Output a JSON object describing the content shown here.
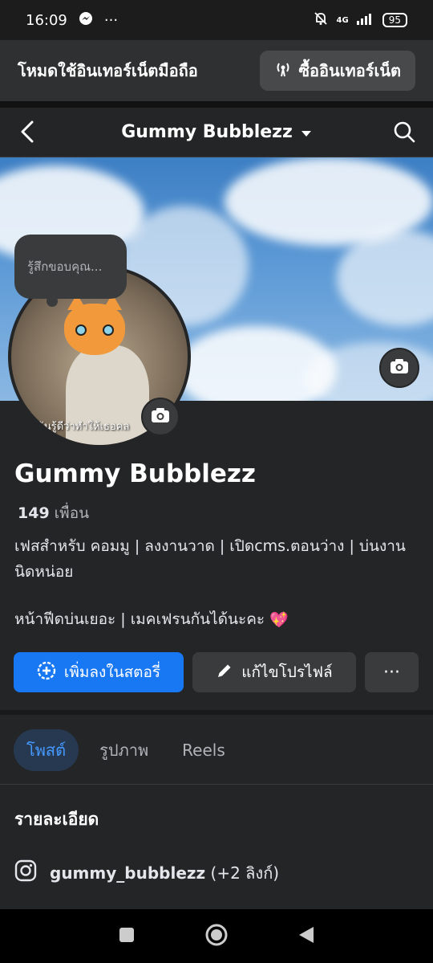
{
  "status": {
    "time": "16:09",
    "network": "4G",
    "battery": "95",
    "icons": [
      "messenger-icon",
      "more-dots-icon",
      "mute-bell-icon",
      "signal-icon"
    ]
  },
  "data_banner": {
    "label": "โหมดใช้อินเทอร์เน็ตมือถือ",
    "buy_button": "ซื้ออินเทอร์เน็ต"
  },
  "topbar": {
    "title": "Gummy Bubblezz"
  },
  "note_bubble": {
    "text": "รู้สึกขอบคุณ..."
  },
  "avatar": {
    "caption": "ฉันรู้ดีว่าทำให้เธอคล"
  },
  "profile": {
    "name": "Gummy Bubblezz",
    "friends_count": "149",
    "friends_label": "เพื่อน",
    "bio_line1": "เฟสสำหรับ คอมมู | ลงงานวาด  | เปิดcms.ตอนว่าง | บ่นงานนิดหน่อย",
    "bio_line2": "หน้าฟีดบ่นเยอะ | เมคเฟรนกันได้นะคะ",
    "bio_emoji": "💖"
  },
  "actions": {
    "add_story": "เพิ่มลงในสตอรี่",
    "edit_profile": "แก้ไขโปรไฟล์",
    "more": "···"
  },
  "tabs": [
    {
      "label": "โพสต์",
      "active": true
    },
    {
      "label": "รูปภาพ",
      "active": false
    },
    {
      "label": "Reels",
      "active": false
    }
  ],
  "details": {
    "title": "รายละเอียด",
    "instagram_handle": "gummy_bubblezz",
    "instagram_extra": "(+2 ลิงก์)"
  },
  "colors": {
    "accent": "#1877f2",
    "background": "#242526",
    "active_tab_bg": "#263951"
  }
}
